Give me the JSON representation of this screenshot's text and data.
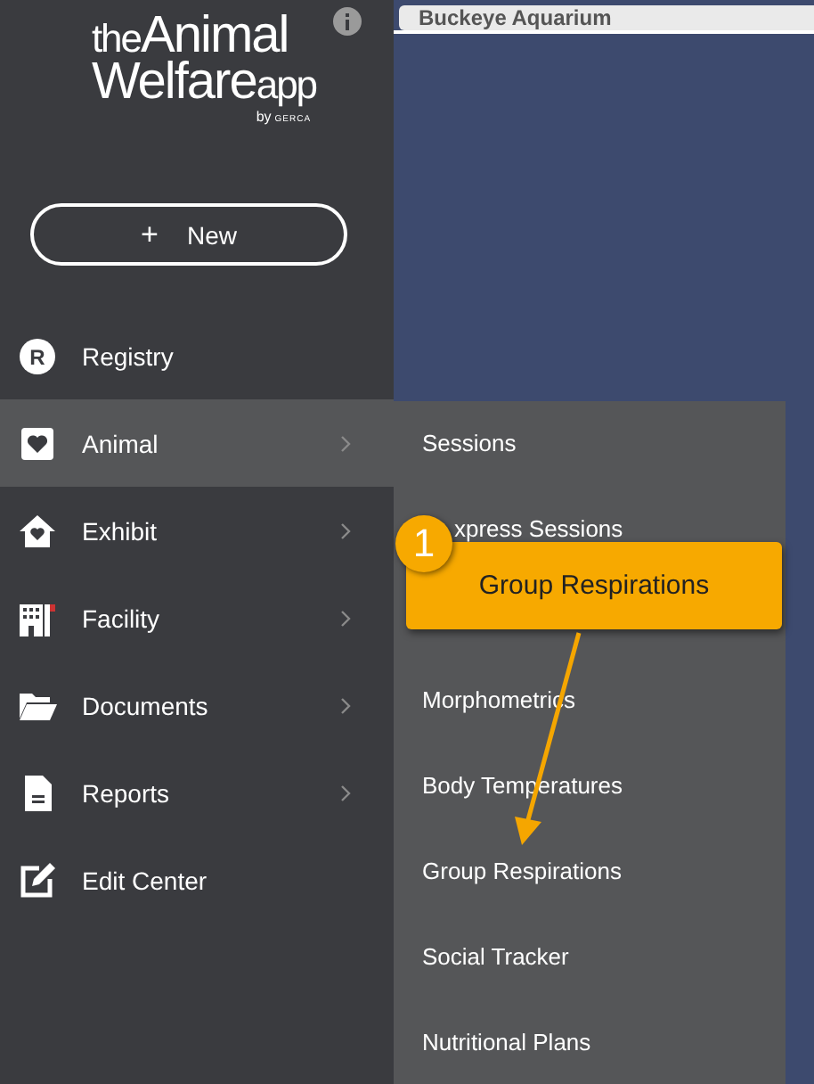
{
  "logo": {
    "line_1_small": "the",
    "line_1_large": "Animal",
    "line_2_large": "Welfare",
    "line_2_small": "app",
    "byline_small": "by",
    "byline_brand": "GERCA"
  },
  "new_button": {
    "icon": "+",
    "label": "New"
  },
  "sidebar": {
    "items": [
      {
        "label": "Registry",
        "icon_letter": "R",
        "has_submenu": false,
        "selected": false
      },
      {
        "label": "Animal",
        "has_submenu": true,
        "selected": true
      },
      {
        "label": "Exhibit",
        "has_submenu": true,
        "selected": false
      },
      {
        "label": "Facility",
        "has_submenu": true,
        "selected": false
      },
      {
        "label": "Documents",
        "has_submenu": true,
        "selected": false
      },
      {
        "label": "Reports",
        "has_submenu": true,
        "selected": false
      },
      {
        "label": "Edit Center",
        "has_submenu": false,
        "selected": false
      }
    ]
  },
  "top_bar": {
    "organization": "Buckeye Aquarium"
  },
  "submenu": {
    "items": [
      "Sessions",
      "xpress Sessions",
      "Morphometrics",
      "Body Temperatures",
      "Group Respirations",
      "Social Tracker",
      "Nutritional Plans"
    ]
  },
  "callout": {
    "step": "1",
    "text": "Group Respirations"
  }
}
